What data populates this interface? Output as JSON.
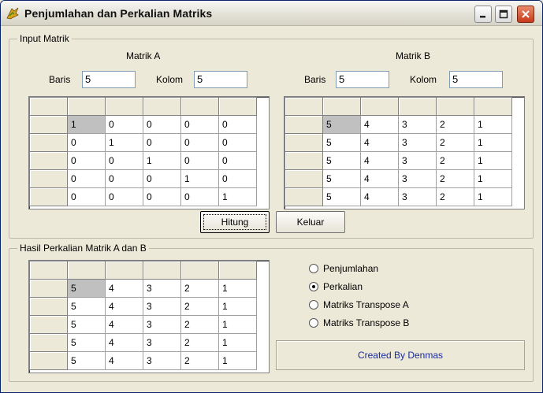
{
  "window": {
    "title": "Penjumlahan dan Perkalian Matriks"
  },
  "input_group": {
    "legend": "Input Matrik",
    "matrix_a": {
      "title": "Matrik A",
      "rows_label": "Baris",
      "rows_value": "5",
      "cols_label": "Kolom",
      "cols_value": "5",
      "cells": [
        [
          "1",
          "0",
          "0",
          "0",
          "0"
        ],
        [
          "0",
          "1",
          "0",
          "0",
          "0"
        ],
        [
          "0",
          "0",
          "1",
          "0",
          "0"
        ],
        [
          "0",
          "0",
          "0",
          "1",
          "0"
        ],
        [
          "0",
          "0",
          "0",
          "0",
          "1"
        ]
      ]
    },
    "matrix_b": {
      "title": "Matrik B",
      "rows_label": "Baris",
      "rows_value": "5",
      "cols_label": "Kolom",
      "cols_value": "5",
      "cells": [
        [
          "5",
          "4",
          "3",
          "2",
          "1"
        ],
        [
          "5",
          "4",
          "3",
          "2",
          "1"
        ],
        [
          "5",
          "4",
          "3",
          "2",
          "1"
        ],
        [
          "5",
          "4",
          "3",
          "2",
          "1"
        ],
        [
          "5",
          "4",
          "3",
          "2",
          "1"
        ]
      ]
    }
  },
  "buttons": {
    "compute": "Hitung",
    "exit": "Keluar"
  },
  "result_group": {
    "legend": "Hasil Perkalian Matrik A dan B",
    "cells": [
      [
        "5",
        "4",
        "3",
        "2",
        "1"
      ],
      [
        "5",
        "4",
        "3",
        "2",
        "1"
      ],
      [
        "5",
        "4",
        "3",
        "2",
        "1"
      ],
      [
        "5",
        "4",
        "3",
        "2",
        "1"
      ],
      [
        "5",
        "4",
        "3",
        "2",
        "1"
      ]
    ]
  },
  "operations": {
    "options": [
      "Penjumlahan",
      "Perkalian",
      "Matriks Transpose A",
      "Matriks Transpose B"
    ],
    "selected": "Perkalian"
  },
  "credit": "Created By Denmas",
  "colors": {
    "credit_text": "#1a2a9a",
    "window_bg": "#ece9d8",
    "close_button": "#c63a1a"
  }
}
